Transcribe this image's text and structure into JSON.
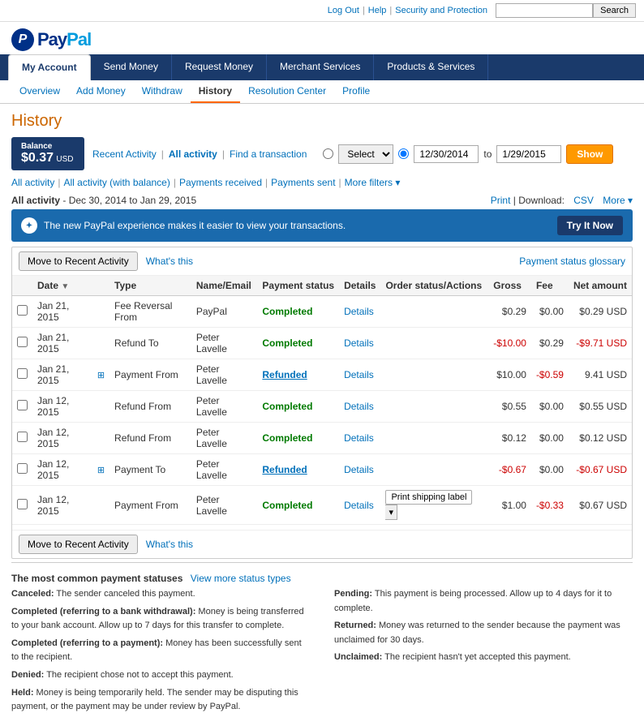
{
  "topbar": {
    "logout": "Log Out",
    "help": "Help",
    "security": "Security and Protection",
    "search_placeholder": "",
    "search_btn": "Search"
  },
  "logo": {
    "p_letter": "P",
    "brand": "PayPal"
  },
  "main_nav": {
    "items": [
      {
        "label": "My Account",
        "active": true
      },
      {
        "label": "Send Money",
        "active": false
      },
      {
        "label": "Request Money",
        "active": false
      },
      {
        "label": "Merchant Services",
        "active": false
      },
      {
        "label": "Products & Services",
        "active": false
      }
    ]
  },
  "sub_nav": {
    "items": [
      {
        "label": "Overview",
        "active": false
      },
      {
        "label": "Add Money",
        "active": false
      },
      {
        "label": "Withdraw",
        "active": false
      },
      {
        "label": "History",
        "active": true
      },
      {
        "label": "Resolution Center",
        "active": false
      },
      {
        "label": "Profile",
        "active": false
      }
    ]
  },
  "page": {
    "title": "History",
    "balance": {
      "label": "Balance",
      "amount": "$0.37",
      "currency": "USD"
    },
    "filter": {
      "recent_activity": "Recent Activity",
      "all_activity": "All activity",
      "find_transaction": "Find a transaction",
      "select_placeholder": "Select",
      "date_from": "12/30/2014",
      "date_to": "1/29/2015",
      "to_label": "to",
      "show_btn": "Show"
    },
    "activity_filters": {
      "all": "All activity",
      "with_balance": "All activity (with balance)",
      "received": "Payments received",
      "sent": "Payments sent",
      "more": "More filters ▾"
    },
    "all_activity": {
      "title": "All activity",
      "date_range": "- Dec 30, 2014 to Jan 29, 2015",
      "print": "Print",
      "download": "Download:",
      "csv": "CSV",
      "more": "More ▾"
    },
    "banner": {
      "icon": "✓",
      "text": "The new PayPal experience makes it easier to view your transactions.",
      "try_btn": "Try It Now"
    },
    "move_bar": {
      "move_btn": "Move to Recent Activity",
      "whats": "What's this",
      "glossary": "Payment status glossary"
    },
    "table": {
      "headers": [
        "",
        "Date",
        "",
        "Type",
        "Name/Email",
        "Payment status",
        "Details",
        "Order status/Actions",
        "Gross",
        "Fee",
        "Net amount"
      ],
      "rows": [
        {
          "date": "Jan 21, 2015",
          "expand": false,
          "type": "Fee Reversal From",
          "name": "PayPal",
          "status": "Completed",
          "status_class": "completed",
          "details": "Details",
          "order_action": "",
          "gross": "$0.29",
          "fee": "$0.00",
          "net": "$0.29 USD",
          "net_neg": false
        },
        {
          "date": "Jan 21, 2015",
          "expand": false,
          "type": "Refund To",
          "name": "Peter Lavelle",
          "status": "Completed",
          "status_class": "completed",
          "details": "Details",
          "order_action": "",
          "gross": "-$10.00",
          "fee": "$0.29",
          "net": "-$9.71 USD",
          "net_neg": true
        },
        {
          "date": "Jan 21, 2015",
          "expand": true,
          "type": "Payment From",
          "name": "Peter Lavelle",
          "status": "Refunded",
          "status_class": "refunded",
          "details": "Details",
          "order_action": "",
          "gross": "$10.00",
          "fee": "-$0.59",
          "net": "9.41 USD",
          "net_neg": false
        },
        {
          "date": "Jan 12, 2015",
          "expand": false,
          "type": "Refund From",
          "name": "Peter Lavelle",
          "status": "Completed",
          "status_class": "completed",
          "details": "Details",
          "order_action": "",
          "gross": "$0.55",
          "fee": "$0.00",
          "net": "$0.55 USD",
          "net_neg": false
        },
        {
          "date": "Jan 12, 2015",
          "expand": false,
          "type": "Refund From",
          "name": "Peter Lavelle",
          "status": "Completed",
          "status_class": "completed",
          "details": "Details",
          "order_action": "",
          "gross": "$0.12",
          "fee": "$0.00",
          "net": "$0.12 USD",
          "net_neg": false
        },
        {
          "date": "Jan 12, 2015",
          "expand": true,
          "type": "Payment To",
          "name": "Peter Lavelle",
          "status": "Refunded",
          "status_class": "refunded",
          "details": "Details",
          "order_action": "",
          "gross": "-$0.67",
          "fee": "$0.00",
          "net": "-$0.67 USD",
          "net_neg": true
        },
        {
          "date": "Jan 12, 2015",
          "expand": false,
          "type": "Payment From",
          "name": "Peter Lavelle",
          "status": "Completed",
          "status_class": "completed",
          "details": "Details",
          "order_action": "print_label",
          "gross": "$1.00",
          "fee": "-$0.33",
          "net": "$0.67 USD",
          "net_neg": false
        }
      ]
    },
    "bottom_move_bar": {
      "move_btn": "Move to Recent Activity",
      "whats": "What's this"
    },
    "status_section": {
      "title": "The most common payment statuses",
      "view_more": "View more status types",
      "statuses_left": [
        {
          "label": "Canceled:",
          "desc": "The sender canceled this payment."
        },
        {
          "label": "Completed (referring to a bank withdrawal):",
          "desc": "Money is being transferred to your bank account. Allow up to 7 days for this transfer to complete."
        },
        {
          "label": "Completed (referring to a payment):",
          "desc": "Money has been successfully sent to the recipient."
        },
        {
          "label": "Denied:",
          "desc": "The recipient chose not to accept this payment."
        },
        {
          "label": "Held:",
          "desc": "Money is being temporarily held. The sender may be disputing this payment, or the payment may be under review by PayPal."
        }
      ],
      "statuses_right": [
        {
          "label": "Pending:",
          "desc": "This payment is being processed. Allow up to 4 days for it to complete."
        },
        {
          "label": "Returned:",
          "desc": "Money was returned to the sender because the payment was unclaimed for 30 days."
        },
        {
          "label": "Unclaimed:",
          "desc": "The recipient hasn't yet accepted this payment."
        }
      ]
    }
  }
}
